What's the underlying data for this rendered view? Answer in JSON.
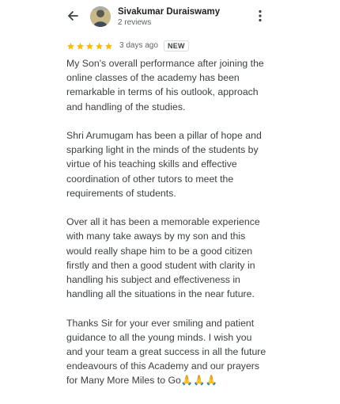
{
  "header": {
    "back_icon": "arrow-back-icon",
    "reviewer_name": "Sivakumar Duraiswamy",
    "review_count": "2 reviews",
    "more_icon": "more-vertical-icon"
  },
  "review": {
    "rating": 5,
    "rating_max": 5,
    "star_color": "#fbbc04",
    "time": "3 days ago",
    "badge": "NEW",
    "paragraphs": [
      "My Son's overall performance after joining the\nonline classes of the academy has been\nremarkable in terms of his outlook, approach\nand handling of the studies.",
      "Shri Arumugam has been a pillar of hope and\nsparking light in the minds of the students by\nvirtue of his teaching skills and effective\ncoordination of other tutors to meet the\nrequirements of students.",
      "Over all it has been a memorable experience\nwith many take aways by my son and this\nwould really shape him to be a good citizen\nfirstly and then a good student with clarity in\nhandling his subject and effectiveness in\nhandling all the situations in the near future.",
      "Thanks Sir for your ever smiling and patient\nguidance to all the young minds. I wish you\nand your team a great success in all the future\nendeavours of this Academy and our prayers\nfor Many More Miles to Go🙏🙏🙏"
    ]
  }
}
